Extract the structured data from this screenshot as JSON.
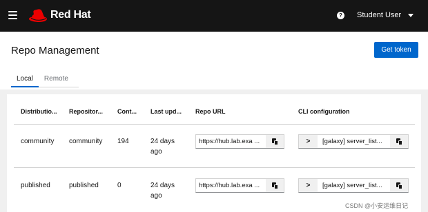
{
  "masthead": {
    "brand": "Red Hat",
    "brand_color": "#ee0000",
    "help_icon_glyph": "?",
    "user_label": "Student User"
  },
  "page": {
    "title": "Repo Management",
    "get_token_label": "Get token",
    "tabs": [
      {
        "label": "Local",
        "active": true
      },
      {
        "label": "Remote",
        "active": false
      }
    ]
  },
  "table": {
    "columns": [
      "Distributio...",
      "Repositor...",
      "Cont...",
      "Last upd...",
      "Repo URL",
      "CLI configuration"
    ],
    "rows": [
      {
        "distribution": "community",
        "repository": "community",
        "content": "194",
        "last_updated": "24 days ago",
        "repo_url": "https://hub.lab.exa ...",
        "cli_expand": ">",
        "cli_config": "[galaxy] server_list..."
      },
      {
        "distribution": "published",
        "repository": "published",
        "content": "0",
        "last_updated": "24 days ago",
        "repo_url": "https://hub.lab.exa ...",
        "cli_expand": ">",
        "cli_config": "[galaxy] server_list..."
      }
    ]
  },
  "watermark": "CSDN @小安运维日记"
}
